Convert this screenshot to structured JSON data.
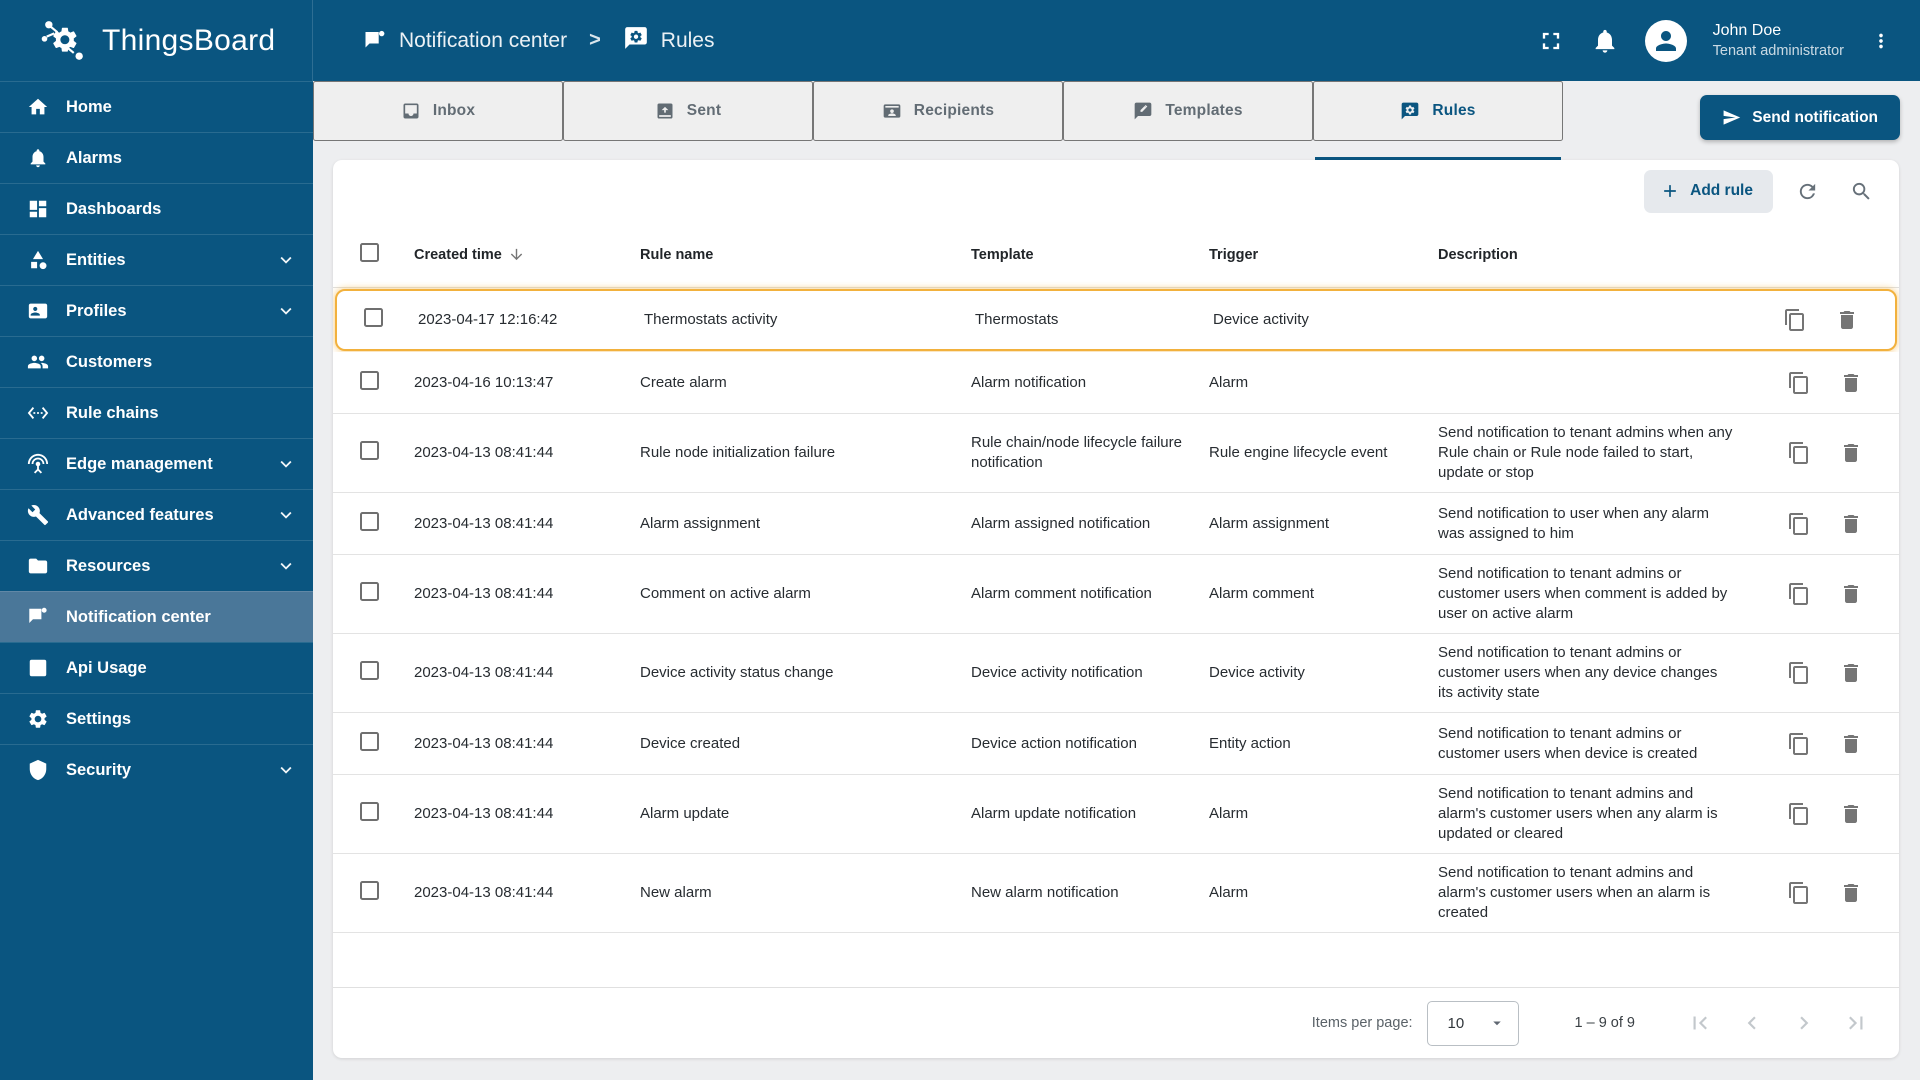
{
  "colors": {
    "brand_blue": "#0a5580",
    "highlight_amber": "#f2b13d"
  },
  "app": {
    "title": "ThingsBoard"
  },
  "header": {
    "breadcrumb": [
      {
        "label": "Notification center",
        "icon": "notification"
      },
      {
        "label": "Rules",
        "icon": "rules"
      }
    ],
    "breadcrumb_separator": ">",
    "user": {
      "name": "John Doe",
      "role": "Tenant administrator"
    },
    "icons": [
      "fullscreen-icon",
      "bell-icon",
      "avatar",
      "more-vert-icon"
    ]
  },
  "sidebar": {
    "items": [
      {
        "label": "Home",
        "icon": "home",
        "expandable": false,
        "active": false
      },
      {
        "label": "Alarms",
        "icon": "bell",
        "expandable": false,
        "active": false
      },
      {
        "label": "Dashboards",
        "icon": "dashboard",
        "expandable": false,
        "active": false
      },
      {
        "label": "Entities",
        "icon": "entities",
        "expandable": true,
        "active": false
      },
      {
        "label": "Profiles",
        "icon": "profiles",
        "expandable": true,
        "active": false
      },
      {
        "label": "Customers",
        "icon": "customers",
        "expandable": false,
        "active": false
      },
      {
        "label": "Rule chains",
        "icon": "rulechains",
        "expandable": false,
        "active": false
      },
      {
        "label": "Edge management",
        "icon": "edge",
        "expandable": true,
        "active": false
      },
      {
        "label": "Advanced features",
        "icon": "tools",
        "expandable": true,
        "active": false
      },
      {
        "label": "Resources",
        "icon": "folder",
        "expandable": true,
        "active": false
      },
      {
        "label": "Notification center",
        "icon": "notification",
        "expandable": false,
        "active": true
      },
      {
        "label": "Api Usage",
        "icon": "apiusage",
        "expandable": false,
        "active": false
      },
      {
        "label": "Settings",
        "icon": "settings",
        "expandable": false,
        "active": false
      },
      {
        "label": "Security",
        "icon": "shield",
        "expandable": true,
        "active": false
      }
    ]
  },
  "tabs": [
    {
      "label": "Inbox",
      "icon": "inbox",
      "active": false
    },
    {
      "label": "Sent",
      "icon": "sent",
      "active": false
    },
    {
      "label": "Recipients",
      "icon": "recipients",
      "active": false
    },
    {
      "label": "Templates",
      "icon": "templates",
      "active": false
    },
    {
      "label": "Rules",
      "icon": "rules",
      "active": true
    }
  ],
  "actions": {
    "send_notification": "Send notification"
  },
  "toolbar": {
    "add_rule": "Add rule"
  },
  "table": {
    "columns": [
      "Created time",
      "Rule name",
      "Template",
      "Trigger",
      "Description"
    ],
    "sorted_column": "Created time",
    "rows": [
      {
        "created": "2023-04-17 12:16:42",
        "name": "Thermostats activity",
        "template": "Thermostats",
        "trigger": "Device activity",
        "description": "",
        "highlighted": true
      },
      {
        "created": "2023-04-16 10:13:47",
        "name": "Create alarm",
        "template": "Alarm notification",
        "trigger": "Alarm",
        "description": "",
        "highlighted": false
      },
      {
        "created": "2023-04-13 08:41:44",
        "name": "Rule node initialization failure",
        "template": "Rule chain/node lifecycle failure notification",
        "trigger": "Rule engine lifecycle event",
        "description": "Send notification to tenant admins when any Rule chain or Rule node failed to start, update or stop",
        "highlighted": false
      },
      {
        "created": "2023-04-13 08:41:44",
        "name": "Alarm assignment",
        "template": "Alarm assigned notification",
        "trigger": "Alarm assignment",
        "description": "Send notification to user when any alarm was assigned to him",
        "highlighted": false
      },
      {
        "created": "2023-04-13 08:41:44",
        "name": "Comment on active alarm",
        "template": "Alarm comment notification",
        "trigger": "Alarm comment",
        "description": "Send notification to tenant admins or customer users when comment is added by user on active alarm",
        "highlighted": false
      },
      {
        "created": "2023-04-13 08:41:44",
        "name": "Device activity status change",
        "template": "Device activity notification",
        "trigger": "Device activity",
        "description": "Send notification to tenant admins or customer users when any device changes its activity state",
        "highlighted": false
      },
      {
        "created": "2023-04-13 08:41:44",
        "name": "Device created",
        "template": "Device action notification",
        "trigger": "Entity action",
        "description": "Send notification to tenant admins or customer users when device is created",
        "highlighted": false
      },
      {
        "created": "2023-04-13 08:41:44",
        "name": "Alarm update",
        "template": "Alarm update notification",
        "trigger": "Alarm",
        "description": "Send notification to tenant admins and alarm's customer users when any alarm is updated or cleared",
        "highlighted": false
      },
      {
        "created": "2023-04-13 08:41:44",
        "name": "New alarm",
        "template": "New alarm notification",
        "trigger": "Alarm",
        "description": "Send notification to tenant admins and alarm's customer users when an alarm is created",
        "highlighted": false
      }
    ]
  },
  "pagination": {
    "items_per_page_label": "Items per page:",
    "page_size": "10",
    "range_label": "1 – 9 of 9"
  }
}
